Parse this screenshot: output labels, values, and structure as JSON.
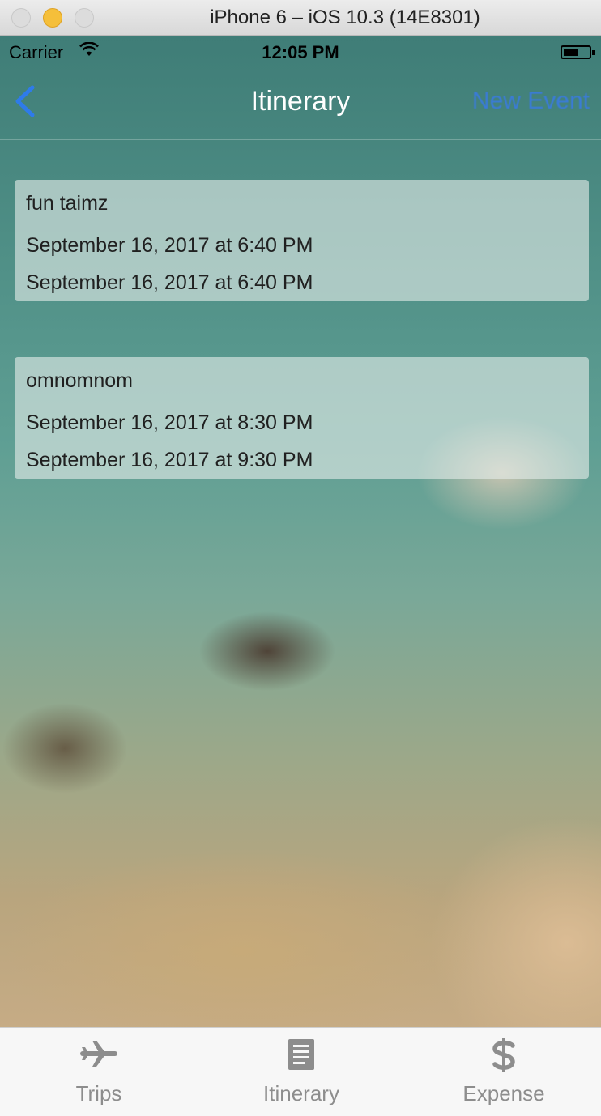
{
  "window": {
    "title": "iPhone 6 – iOS 10.3 (14E8301)"
  },
  "status_bar": {
    "carrier": "Carrier",
    "time": "12:05 PM"
  },
  "nav": {
    "back_icon": "chevron-left-icon",
    "title": "Itinerary",
    "action": "New Event",
    "accent": "#2e7bea"
  },
  "events": [
    {
      "name": "fun taimz",
      "start": "September 16, 2017 at  6:40 PM",
      "end": "September 16, 2017 at  6:40 PM"
    },
    {
      "name": "omnomnom",
      "start": "September 16, 2017 at  8:30 PM",
      "end": "September 16, 2017 at  9:30 PM"
    }
  ],
  "tabs": [
    {
      "label": "Trips",
      "icon": "airplane-icon"
    },
    {
      "label": "Itinerary",
      "icon": "document-icon"
    },
    {
      "label": "Expense",
      "icon": "dollar-icon"
    }
  ]
}
